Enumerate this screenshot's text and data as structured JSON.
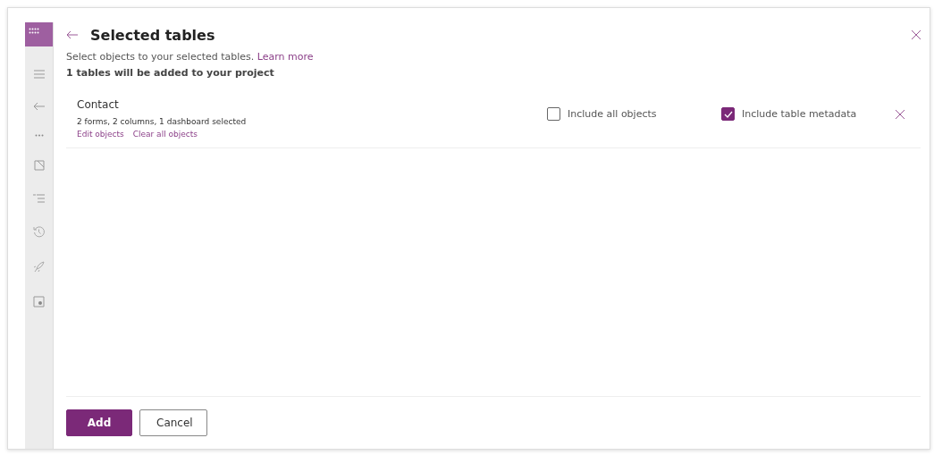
{
  "panel": {
    "title": "Selected tables",
    "description": "Select objects to your selected tables.",
    "learn_more": "Learn more",
    "summary": "1 tables will be added to your project"
  },
  "tables": [
    {
      "name": "Contact",
      "detail": "2 forms, 2 columns, 1 dashboard selected",
      "links": [
        "Edit objects",
        "Clear all objects"
      ],
      "options": [
        {
          "label": "Include all objects",
          "checked": false
        },
        {
          "label": "Include table metadata",
          "checked": true
        }
      ]
    }
  ],
  "buttons": [
    {
      "label": "Add",
      "kind": "primary"
    },
    {
      "label": "Cancel",
      "kind": "secondary"
    }
  ]
}
